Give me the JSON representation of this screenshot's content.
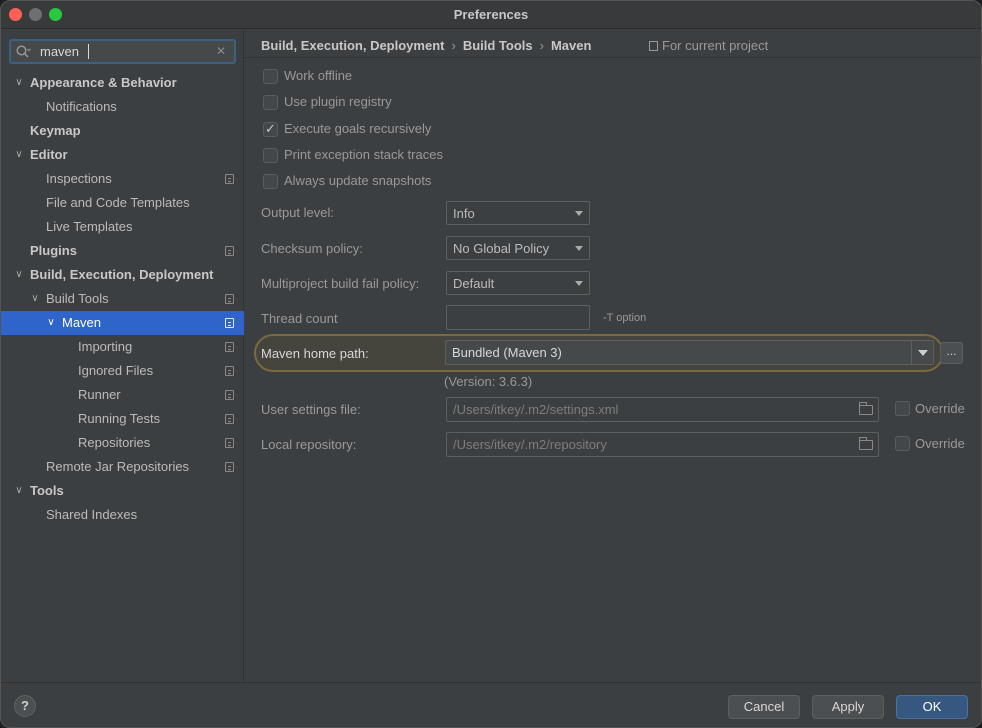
{
  "window": {
    "title": "Preferences"
  },
  "search": {
    "value": "maven"
  },
  "sidebar": {
    "items": [
      {
        "label": "Appearance & Behavior",
        "bold": true,
        "arrow": true
      },
      {
        "label": "Notifications"
      },
      {
        "label": "Keymap",
        "bold": true
      },
      {
        "label": "Editor",
        "bold": true,
        "arrow": true
      },
      {
        "label": "Inspections"
      },
      {
        "label": "File and Code Templates"
      },
      {
        "label": "Live Templates"
      },
      {
        "label": "Plugins",
        "bold": true
      },
      {
        "label": "Build, Execution, Deployment",
        "bold": true,
        "arrow": true
      },
      {
        "label": "Build Tools"
      },
      {
        "label": "Maven"
      },
      {
        "label": "Importing"
      },
      {
        "label": "Ignored Files"
      },
      {
        "label": "Runner"
      },
      {
        "label": "Running Tests"
      },
      {
        "label": "Repositories"
      },
      {
        "label": "Remote Jar Repositories"
      },
      {
        "label": "Tools",
        "bold": true,
        "arrow": true
      },
      {
        "label": "Shared Indexes"
      }
    ]
  },
  "breadcrumb": {
    "items": [
      "Build, Execution, Deployment",
      "Build Tools",
      "Maven"
    ],
    "separator": "›",
    "scope": "For current project"
  },
  "options": {
    "work_offline": {
      "label": "Work offline",
      "checked": false
    },
    "use_plugin_registry": {
      "label": "Use plugin registry",
      "checked": false
    },
    "execute_goals_recursively": {
      "label": "Execute goals recursively",
      "checked": true
    },
    "print_exception_stack_traces": {
      "label": "Print exception stack traces",
      "checked": false
    },
    "always_update_snapshots": {
      "label": "Always update snapshots",
      "checked": false
    }
  },
  "fields": {
    "output_level": {
      "label": "Output level:",
      "value": "Info"
    },
    "checksum_policy": {
      "label": "Checksum policy:",
      "value": "No Global Policy"
    },
    "multiproject_fail_policy": {
      "label": "Multiproject build fail policy:",
      "value": "Default"
    },
    "thread_count": {
      "label": "Thread count",
      "value": "",
      "hint": "-T option"
    },
    "maven_home_path": {
      "label": "Maven home path:",
      "value": "Bundled (Maven 3)",
      "browse": "...",
      "version": "(Version: 3.6.3)"
    },
    "user_settings_file": {
      "label": "User settings file:",
      "value": "/Users/itkey/.m2/settings.xml",
      "override": "Override"
    },
    "local_repository": {
      "label": "Local repository:",
      "value": "/Users/itkey/.m2/repository",
      "override": "Override"
    }
  },
  "footer": {
    "help": "?",
    "cancel": "Cancel",
    "apply": "Apply",
    "ok": "OK"
  },
  "colors": {
    "selection": "#2f65ca",
    "primary_button": "#365880",
    "highlight_ring": "#7a6a3f"
  }
}
